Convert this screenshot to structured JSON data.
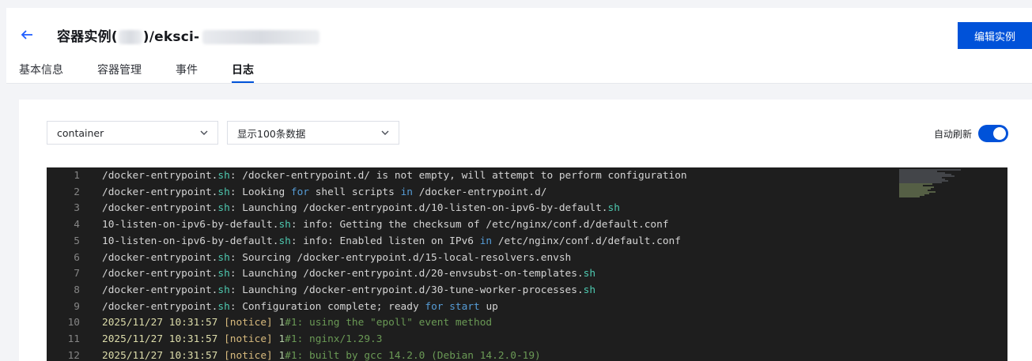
{
  "header": {
    "title_prefix": "容器实例(",
    "title_mid": ")/eksci-",
    "edit_button": "编辑实例"
  },
  "tabs": [
    {
      "label": "基本信息",
      "active": false
    },
    {
      "label": "容器管理",
      "active": false
    },
    {
      "label": "事件",
      "active": false
    },
    {
      "label": "日志",
      "active": true
    }
  ],
  "filters": {
    "container_select": "container",
    "count_select": "显示100条数据",
    "auto_refresh_label": "自动刷新",
    "auto_refresh_on": true
  },
  "colors": {
    "accent": "#0052d9",
    "log_bg": "#1e1e1e"
  },
  "log_lines": [
    {
      "n": "1",
      "parts": [
        [
          "txt",
          "/docker-entrypoint."
        ],
        [
          "ext",
          "sh"
        ],
        [
          "txt",
          ": /docker-entrypoint.d/ is not empty, will attempt to perform configuration"
        ]
      ]
    },
    {
      "n": "2",
      "parts": [
        [
          "txt",
          "/docker-entrypoint."
        ],
        [
          "ext",
          "sh"
        ],
        [
          "txt",
          ": Looking "
        ],
        [
          "kw",
          "for"
        ],
        [
          "txt",
          " shell scripts "
        ],
        [
          "kw",
          "in"
        ],
        [
          "txt",
          " /docker-entrypoint.d/"
        ]
      ]
    },
    {
      "n": "3",
      "parts": [
        [
          "txt",
          "/docker-entrypoint."
        ],
        [
          "ext",
          "sh"
        ],
        [
          "txt",
          ": Launching /docker-entrypoint.d/10-listen-on-ipv6-by-default."
        ],
        [
          "ext",
          "sh"
        ]
      ]
    },
    {
      "n": "4",
      "parts": [
        [
          "txt",
          "10-listen-on-ipv6-by-default."
        ],
        [
          "ext",
          "sh"
        ],
        [
          "txt",
          ": info: Getting the checksum of /etc/nginx/conf.d/default.conf"
        ]
      ]
    },
    {
      "n": "5",
      "parts": [
        [
          "txt",
          "10-listen-on-ipv6-by-default."
        ],
        [
          "ext",
          "sh"
        ],
        [
          "txt",
          ": info: Enabled listen on IPv6 "
        ],
        [
          "kw",
          "in"
        ],
        [
          "txt",
          " /etc/nginx/conf.d/default.conf"
        ]
      ]
    },
    {
      "n": "6",
      "parts": [
        [
          "txt",
          "/docker-entrypoint."
        ],
        [
          "ext",
          "sh"
        ],
        [
          "txt",
          ": Sourcing /docker-entrypoint.d/15-local-resolvers.envsh"
        ]
      ]
    },
    {
      "n": "7",
      "parts": [
        [
          "txt",
          "/docker-entrypoint."
        ],
        [
          "ext",
          "sh"
        ],
        [
          "txt",
          ": Launching /docker-entrypoint.d/20-envsubst-on-templates."
        ],
        [
          "ext",
          "sh"
        ]
      ]
    },
    {
      "n": "8",
      "parts": [
        [
          "txt",
          "/docker-entrypoint."
        ],
        [
          "ext",
          "sh"
        ],
        [
          "txt",
          ": Launching /docker-entrypoint.d/30-tune-worker-processes."
        ],
        [
          "ext",
          "sh"
        ]
      ]
    },
    {
      "n": "9",
      "parts": [
        [
          "txt",
          "/docker-entrypoint."
        ],
        [
          "ext",
          "sh"
        ],
        [
          "txt",
          ": Configuration complete; ready "
        ],
        [
          "kw",
          "for"
        ],
        [
          "txt",
          " "
        ],
        [
          "kw",
          "start"
        ],
        [
          "txt",
          " up"
        ]
      ]
    },
    {
      "n": "10",
      "parts": [
        [
          "date",
          "2025/11/27 10:31:57 "
        ],
        [
          "notice-b",
          "[notice]"
        ],
        [
          "txt",
          " "
        ],
        [
          "pid",
          "1"
        ],
        [
          "cmt",
          "#1: using the \"epoll\" event method"
        ]
      ]
    },
    {
      "n": "11",
      "parts": [
        [
          "date",
          "2025/11/27 10:31:57 "
        ],
        [
          "notice-b",
          "[notice]"
        ],
        [
          "txt",
          " "
        ],
        [
          "pid",
          "1"
        ],
        [
          "cmt",
          "#1: nginx/1.29.3"
        ]
      ]
    },
    {
      "n": "12",
      "parts": [
        [
          "date",
          "2025/11/27 10:31:57 "
        ],
        [
          "notice-b",
          "[notice]"
        ],
        [
          "txt",
          " "
        ],
        [
          "pid",
          "1"
        ],
        [
          "cmt",
          "#1: built by gcc 14.2.0 (Debian 14.2.0-19)"
        ]
      ]
    }
  ]
}
